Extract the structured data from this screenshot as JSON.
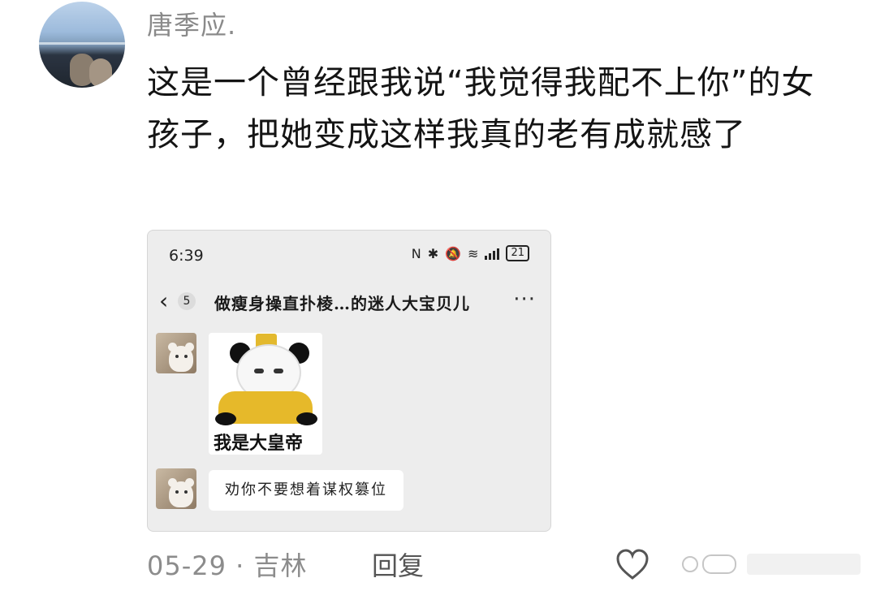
{
  "post": {
    "username": "唐季应.",
    "text": "这是一个曾经跟我说“我觉得我配不上你”的女孩子，把她变成这样我真的老有成就感了",
    "date": "05-29",
    "separator": "·",
    "location": "吉林",
    "reply_label": "回复"
  },
  "screenshot": {
    "status_time": "6:39",
    "battery": "21",
    "unread_count": "5",
    "chat_title": "做瘦身操直扑棱…的迷人大宝贝儿",
    "more": "···",
    "sticker_caption": "我是大皇帝",
    "message_text": "劝你不要想着谋权篡位"
  },
  "icons": [
    "avatar",
    "nfc-icon",
    "bluetooth-icon",
    "mute-icon",
    "wifi-icon",
    "signal-icon",
    "battery-icon",
    "back-icon",
    "more-icon",
    "heart-icon"
  ],
  "colors": {
    "meta_gray": "#8c8c8c",
    "chat_bg": "#ededed",
    "sticker_gold": "#e6b92a"
  }
}
